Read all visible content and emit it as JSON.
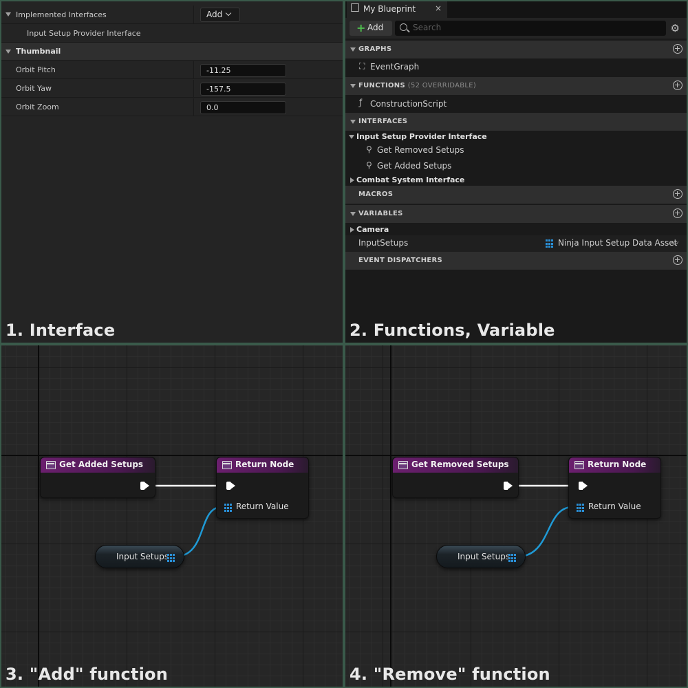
{
  "q1": {
    "caption": "1. Interface",
    "implemented_interfaces_label": "Implemented Interfaces",
    "add_label": "Add",
    "interface_entry": "Input Setup Provider Interface",
    "thumbnail_section": "Thumbnail",
    "rows": [
      {
        "label": "Orbit Pitch",
        "value": "-11.25"
      },
      {
        "label": "Orbit Yaw",
        "value": "-157.5"
      },
      {
        "label": "Orbit Zoom",
        "value": "0.0"
      }
    ]
  },
  "q2": {
    "caption": "2. Functions, Variable",
    "tab_title": "My Blueprint",
    "close_glyph": "×",
    "add_label": "Add",
    "search_placeholder": "Search",
    "graphs_header": "GRAPHS",
    "event_graph": "EventGraph",
    "functions_header": "FUNCTIONS",
    "functions_sub": "(52 OVERRIDABLE)",
    "construction_script": "ConstructionScript",
    "interfaces_header": "INTERFACES",
    "interface1": "Input Setup Provider Interface",
    "interface1_fn1": "Get Removed Setups",
    "interface1_fn2": "Get Added Setups",
    "interface2": "Combat System Interface",
    "macros_header": "MACROS",
    "variables_header": "VARIABLES",
    "var_category": "Camera",
    "var_name": "InputSetups",
    "var_type": "Ninja Input Setup Data Asset",
    "event_dispatchers_header": "EVENT DISPATCHERS",
    "accent_blue": "#2a8fd6",
    "add_green": "#4fbf4f"
  },
  "q3": {
    "caption": "3. \"Add\" function",
    "entry_node": "Get Added Setups",
    "return_node": "Return Node",
    "return_value": "Return Value",
    "var_node": "Input Setups"
  },
  "q4": {
    "caption": "4. \"Remove\" function",
    "entry_node": "Get Removed Setups",
    "return_node": "Return Node",
    "return_value": "Return Value",
    "var_node": "Input Setups"
  },
  "colors": {
    "function_header": "#6b1f6e",
    "object_wire": "#1f9ad6",
    "exec_wire": "#ffffff"
  }
}
